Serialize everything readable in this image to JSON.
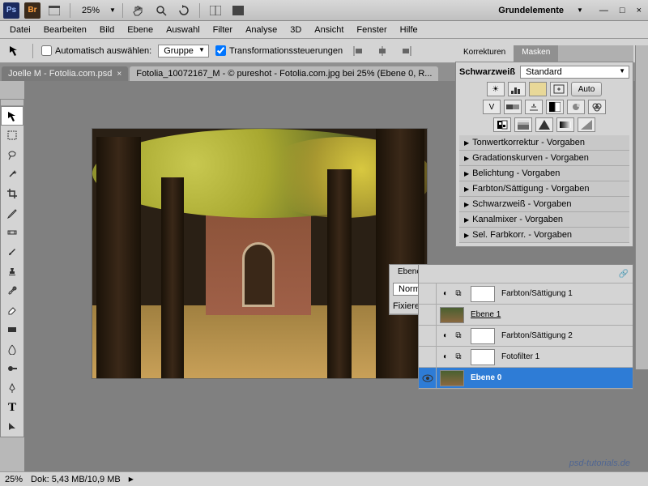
{
  "topbar": {
    "zoom": "25%",
    "workspace": "Grundelemente"
  },
  "menu": [
    "Datei",
    "Bearbeiten",
    "Bild",
    "Ebene",
    "Auswahl",
    "Filter",
    "Analyse",
    "3D",
    "Ansicht",
    "Fenster",
    "Hilfe"
  ],
  "options": {
    "auto_select": "Automatisch auswählen:",
    "group": "Gruppe",
    "transform": "Transformationssteuerungen"
  },
  "tabs": [
    {
      "label": "Joelle M - Fotolia.com.psd",
      "active": false
    },
    {
      "label": "Fotolia_10072167_M - © pureshot - Fotolia.com.jpg bei 25% (Ebene 0, R...",
      "active": true
    }
  ],
  "status": {
    "zoom": "25%",
    "doc": "Dok: 5,43 MB/10,9 MB"
  },
  "korrekturen": {
    "tab1": "Korrekturen",
    "tab2": "Masken",
    "adj_label": "Schwarzweiß",
    "preset": "Standard",
    "auto": "Auto",
    "presets": [
      "Tonwertkorrektur - Vorgaben",
      "Gradationskurven - Vorgaben",
      "Belichtung - Vorgaben",
      "Farbton/Sättigung - Vorgaben",
      "Schwarzweiß - Vorgaben",
      "Kanalmixer - Vorgaben",
      "Sel. Farbkorr. - Vorgaben"
    ]
  },
  "layers": {
    "tab": "Ebenen",
    "mode": "Normal",
    "lock": "Fixieren:",
    "items": [
      {
        "name": "Farbton/Sättigung 1",
        "visible": false,
        "type": "adj"
      },
      {
        "name": "Ebene 1",
        "visible": false,
        "type": "img",
        "underline": true
      },
      {
        "name": "Farbton/Sättigung 2",
        "visible": false,
        "type": "adj"
      },
      {
        "name": "Fotofilter 1",
        "visible": false,
        "type": "adj"
      },
      {
        "name": "Ebene 0",
        "visible": true,
        "type": "img",
        "selected": true
      }
    ]
  },
  "watermark": "psd-tutorials.de"
}
